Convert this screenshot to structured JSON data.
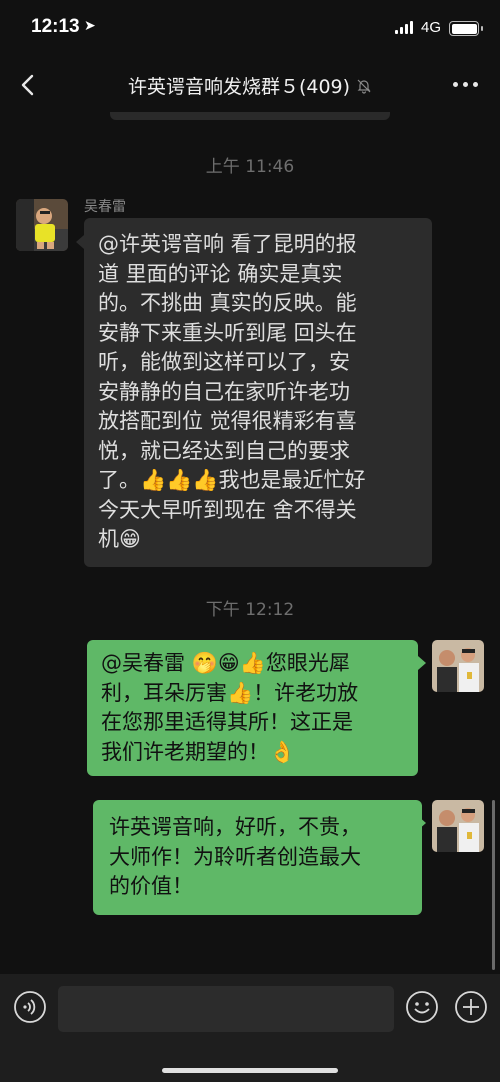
{
  "status_bar": {
    "time": "12:13",
    "network": "4G"
  },
  "header": {
    "title": "许英谔音响发烧群５(409)",
    "mute_icon": "bell-slash-icon"
  },
  "messages": [
    {
      "type": "timestamp",
      "text": "上午 11:46"
    },
    {
      "type": "incoming",
      "sender": "吴春雷",
      "lines": [
        "@许英谔音响 看了昆明的报",
        "道 里面的评论 确实是真实",
        "的。不挑曲 真实的反映。能",
        "安静下来重头听到尾 回头在",
        "听，能做到这样可以了，安",
        "安静静的自己在家听许老功",
        "放搭配到位 觉得很精彩有喜",
        "悦，就已经达到自己的要求",
        "了。👍👍👍我也是最近忙好",
        "今天大早听到现在 舍不得关",
        "机😁"
      ]
    },
    {
      "type": "timestamp",
      "text": "下午 12:12"
    },
    {
      "type": "outgoing",
      "lines": [
        "@吴春雷 🤭😁👍您眼光犀",
        "利，耳朵厉害👍！许老功放",
        "在您那里适得其所！这正是",
        "我们许老期望的！👌"
      ]
    },
    {
      "type": "outgoing",
      "lines": [
        "许英谔音响，好听，不贵，",
        "大师作！为聆听者创造最大",
        "的价值！"
      ]
    }
  ],
  "colors": {
    "background": "#111111",
    "bubble_in": "#2c2c2c",
    "bubble_out": "#5fb867",
    "input_bar": "#1e1e1e"
  }
}
